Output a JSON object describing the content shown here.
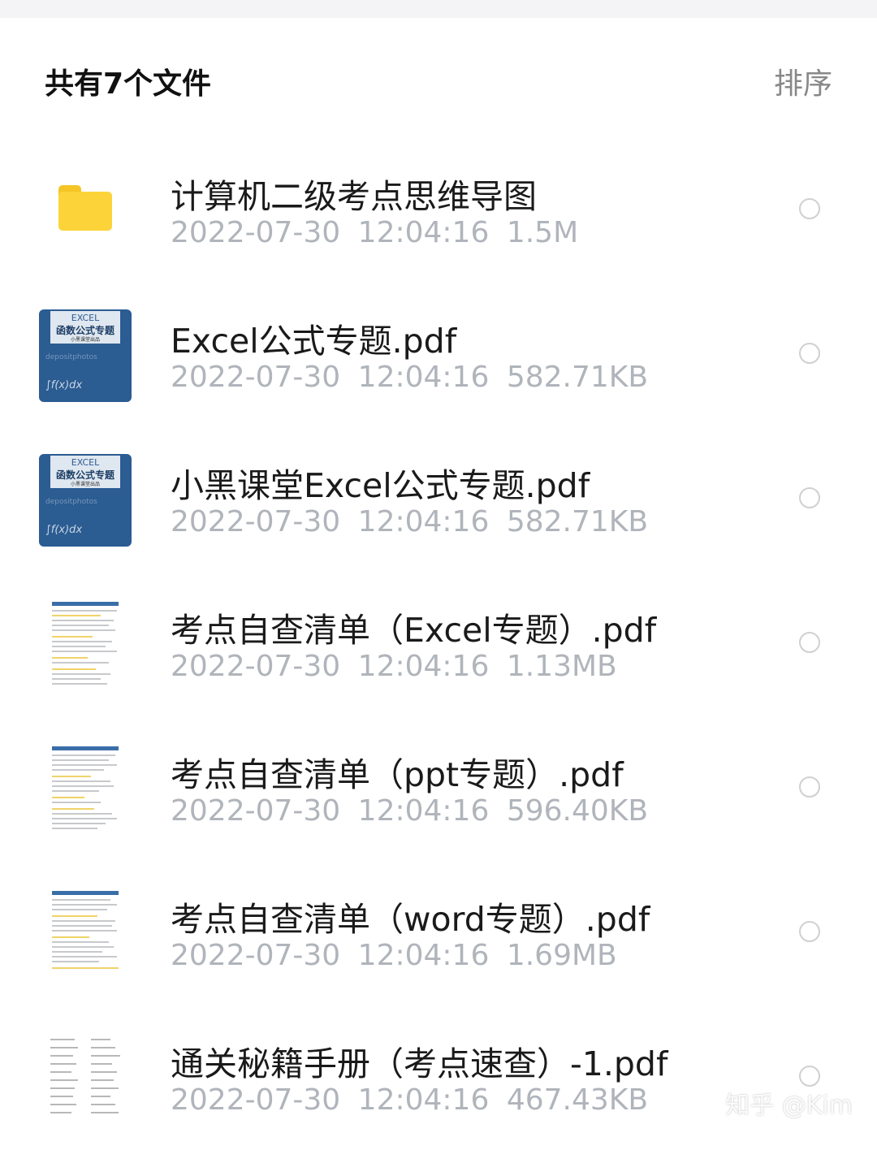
{
  "header": {
    "count_label": "共有7个文件",
    "sort_label": "排序"
  },
  "files": [
    {
      "name": "计算机二级考点思维导图",
      "date": "2022-07-30",
      "time": "12:04:16",
      "size": "1.5M",
      "icon": "folder-icon"
    },
    {
      "name": "Excel公式专题.pdf",
      "date": "2022-07-30",
      "time": "12:04:16",
      "size": "582.71KB",
      "icon": "excel-cover-thumbnail"
    },
    {
      "name": "小黑课堂Excel公式专题.pdf",
      "date": "2022-07-30",
      "time": "12:04:16",
      "size": "582.71KB",
      "icon": "excel-cover-thumbnail"
    },
    {
      "name": "考点自查清单（Excel专题）.pdf",
      "date": "2022-07-30",
      "time": "12:04:16",
      "size": "1.13MB",
      "icon": "document-thumbnail"
    },
    {
      "name": "考点自查清单（ppt专题）.pdf",
      "date": "2022-07-30",
      "time": "12:04:16",
      "size": "596.40KB",
      "icon": "document-thumbnail"
    },
    {
      "name": "考点自查清单（word专题）.pdf",
      "date": "2022-07-30",
      "time": "12:04:16",
      "size": "1.69MB",
      "icon": "document-thumbnail"
    },
    {
      "name": "通关秘籍手册（考点速查）-1.pdf",
      "date": "2022-07-30",
      "time": "12:04:16",
      "size": "467.43KB",
      "icon": "document-thumbnail"
    }
  ],
  "thumb_cover": {
    "line1": "EXCEL",
    "line2": "函数公式专题",
    "line3": "小黑课堂出品",
    "watermark": "depositphotos",
    "formula": "∫f(x)dx"
  },
  "watermark": "知乎 @Kim",
  "colors": {
    "folder": "#fcd43a",
    "cover_bg": "#2b5c92",
    "meta_text": "#b0b4bb"
  }
}
